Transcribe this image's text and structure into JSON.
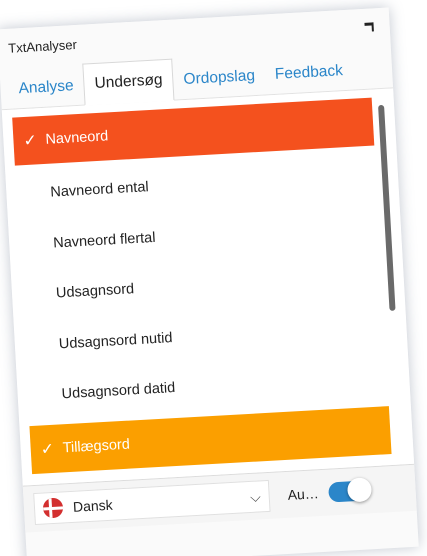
{
  "app": {
    "title": "TxtAnalyser"
  },
  "tabs": [
    {
      "label": "Analyse",
      "active": false
    },
    {
      "label": "Undersøg",
      "active": true
    },
    {
      "label": "Ordopslag",
      "active": false
    },
    {
      "label": "Feedback",
      "active": false
    }
  ],
  "list": {
    "categories": [
      {
        "label": "Navneord",
        "checked": true,
        "color": "#f4511e"
      },
      {
        "label": "Tillægsord",
        "checked": true,
        "color": "#fb9f00"
      }
    ],
    "items": [
      "Navneord ental",
      "Navneord flertal",
      "Udsagnsord",
      "Udsagnsord nutid",
      "Udsagnsord datid"
    ]
  },
  "footer": {
    "language": "Dansk",
    "auto_label": "Au…",
    "toggle_on": true
  },
  "colors": {
    "accent": "#2b86c9"
  }
}
